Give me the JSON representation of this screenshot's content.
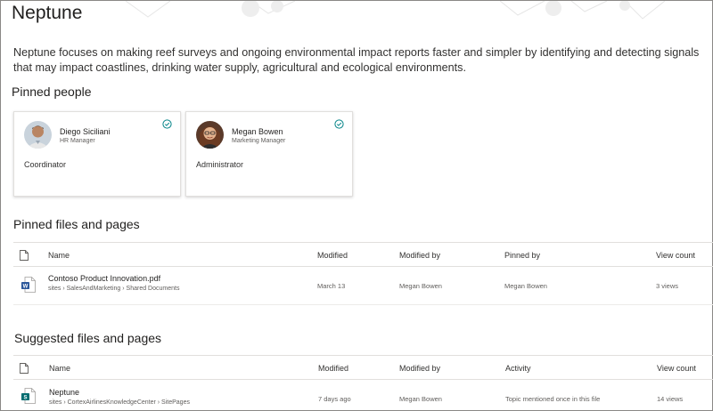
{
  "page": {
    "title": "Neptune",
    "description": "Neptune focuses on making reef surveys and ongoing environmental impact reports faster and simpler by identifying and detecting signals that may impact coastlines, drinking water supply, agricultural and ecological environments."
  },
  "pinned_people": {
    "title": "Pinned people",
    "people": [
      {
        "name": "Diego Siciliani",
        "job_title": "HR Manager",
        "role": "Coordinator"
      },
      {
        "name": "Megan Bowen",
        "job_title": "Marketing Manager",
        "role": "Administrator"
      }
    ]
  },
  "pinned_files": {
    "title": "Pinned files and pages",
    "columns": [
      "Name",
      "Modified",
      "Modified by",
      "Pinned by",
      "View count"
    ],
    "rows": [
      {
        "icon": "word-document-icon",
        "name": "Contoso Product Innovation.pdf",
        "path": "sites › SalesAndMarketing › Shared Documents",
        "modified": "March 13",
        "modified_by": "Megan Bowen",
        "pinned_by": "Megan Bowen",
        "views": "3 views"
      }
    ]
  },
  "suggested_files": {
    "title": "Suggested files and pages",
    "columns": [
      "Name",
      "Modified",
      "Modified by",
      "Activity",
      "View count"
    ],
    "rows": [
      {
        "icon": "sharepoint-page-icon",
        "name": "Neptune",
        "path": "sites › CortexAirlinesKnowledgeCenter › SitePages",
        "modified": "7 days ago",
        "modified_by": "Megan Bowen",
        "activity": "Topic mentioned once in this file",
        "views": "14 views"
      }
    ]
  },
  "colors": {
    "accent_teal": "#038387",
    "word_blue": "#2b579a",
    "sharepoint_teal": "#036c70"
  }
}
